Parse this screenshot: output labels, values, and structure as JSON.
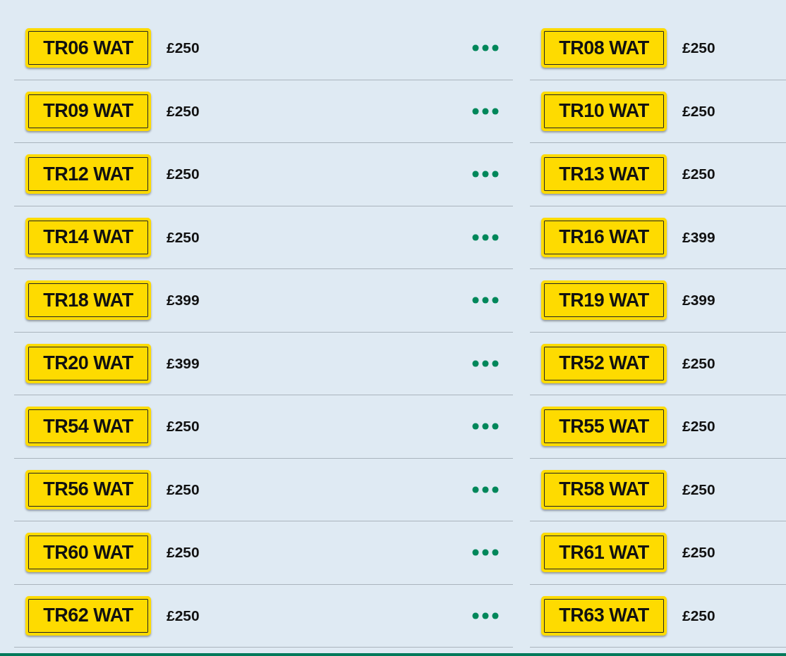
{
  "columns": [
    {
      "show_more": true,
      "items": [
        {
          "plate": "TR06 WAT",
          "price": "£250"
        },
        {
          "plate": "TR09 WAT",
          "price": "£250"
        },
        {
          "plate": "TR12 WAT",
          "price": "£250"
        },
        {
          "plate": "TR14 WAT",
          "price": "£250"
        },
        {
          "plate": "TR18 WAT",
          "price": "£399"
        },
        {
          "plate": "TR20 WAT",
          "price": "£399"
        },
        {
          "plate": "TR54 WAT",
          "price": "£250"
        },
        {
          "plate": "TR56 WAT",
          "price": "£250"
        },
        {
          "plate": "TR60 WAT",
          "price": "£250"
        },
        {
          "plate": "TR62 WAT",
          "price": "£250"
        }
      ]
    },
    {
      "items": [
        {
          "plate": "TR08 WAT",
          "price": "£250"
        },
        {
          "plate": "TR10 WAT",
          "price": "£250"
        },
        {
          "plate": "TR13 WAT",
          "price": "£250"
        },
        {
          "plate": "TR16 WAT",
          "price": "£399"
        },
        {
          "plate": "TR19 WAT",
          "price": "£399"
        },
        {
          "plate": "TR52 WAT",
          "price": "£250"
        },
        {
          "plate": "TR55 WAT",
          "price": "£250"
        },
        {
          "plate": "TR58 WAT",
          "price": "£250"
        },
        {
          "plate": "TR61 WAT",
          "price": "£250"
        },
        {
          "plate": "TR63 WAT",
          "price": "£250"
        }
      ]
    }
  ]
}
